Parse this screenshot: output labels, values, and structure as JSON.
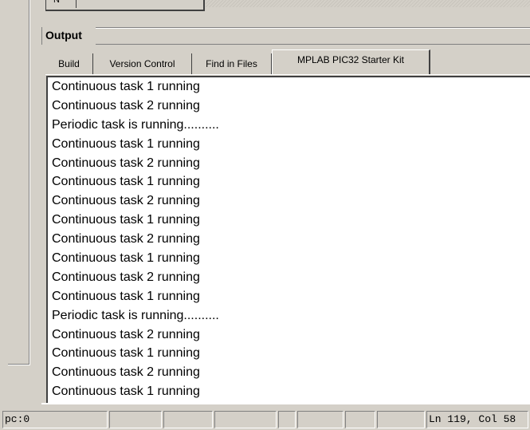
{
  "top_control": {
    "glyph": "N"
  },
  "output_panel": {
    "title": "Output",
    "tabs": [
      {
        "label": "Build",
        "active": false
      },
      {
        "label": "Version Control",
        "active": false
      },
      {
        "label": "Find in Files",
        "active": false
      },
      {
        "label": "MPLAB PIC32 Starter Kit",
        "active": true
      }
    ],
    "lines": [
      "Continuous task 1 running",
      "Continuous task 2 running",
      "Periodic task is running..........",
      "Continuous task 1 running",
      "Continuous task 2 running",
      "Continuous task 1 running",
      "Continuous task 2 running",
      "Continuous task 1 running",
      "Continuous task 2 running",
      "Continuous task 1 running",
      "Continuous task 2 running",
      "Continuous task 1 running",
      "Periodic task is running..........",
      "Continuous task 2 running",
      "Continuous task 1 running",
      "Continuous task 2 running",
      "Continuous task 1 running"
    ]
  },
  "status_bar": {
    "cells": [
      "pc:0",
      "",
      "",
      "",
      "",
      "",
      "",
      "",
      "Ln 119, Col 58"
    ]
  }
}
